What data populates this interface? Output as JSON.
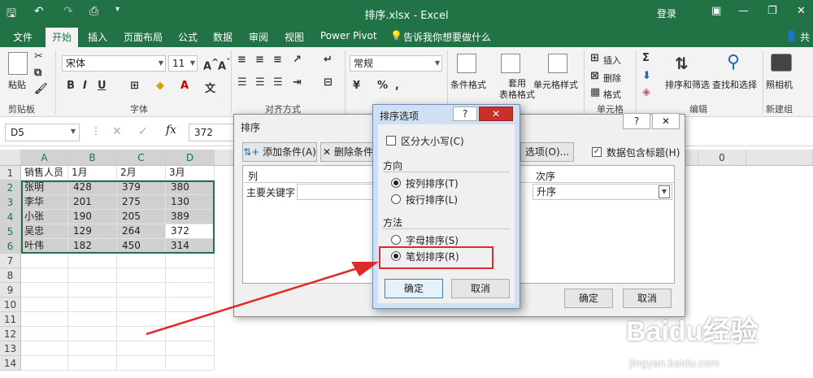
{
  "window": {
    "title": "排序.xlsx  -  Excel",
    "login": "登录"
  },
  "tabs": [
    "文件",
    "开始",
    "插入",
    "页面布局",
    "公式",
    "数据",
    "审阅",
    "视图",
    "Power Pivot"
  ],
  "tell_me": "告诉我你想要做什么",
  "share": "共",
  "ribbon": {
    "paste": "粘贴",
    "clipboard": "剪贴板",
    "font_name": "宋体",
    "font_size": "11",
    "font_group": "字体",
    "align_group": "对齐方式",
    "number_format": "常规",
    "cond_format": "条件格式",
    "table_format": "套用\n表格格式",
    "cell_style": "单元格样式",
    "insert": "插入",
    "delete": "删除",
    "format": "格式",
    "cells_group": "单元格",
    "sort_filter": "排序和筛选",
    "find_select": "查找和选择",
    "edit_group": "编辑",
    "camera": "照相机",
    "new_group": "新建组"
  },
  "formula_bar": {
    "name_box": "D5",
    "value": "372"
  },
  "grid": {
    "columns": [
      "A",
      "B",
      "C",
      "D"
    ],
    "rows": [
      [
        "销售人员",
        "1月",
        "2月",
        "3月"
      ],
      [
        "张明",
        "428",
        "379",
        "380"
      ],
      [
        "李华",
        "201",
        "275",
        "130"
      ],
      [
        "小张",
        "190",
        "205",
        "389"
      ],
      [
        "吴忠",
        "129",
        "264",
        "372"
      ],
      [
        "叶伟",
        "182",
        "450",
        "314"
      ]
    ],
    "row_numbers": [
      "1",
      "2",
      "3",
      "4",
      "5",
      "6",
      "7",
      "8",
      "9",
      "10",
      "11",
      "12",
      "13",
      "14"
    ],
    "extra_col": "0"
  },
  "sort_dialog": {
    "title": "排序",
    "add_condition": "添加条件(A)",
    "delete_condition": "删除条件",
    "options": "选项(O)...",
    "has_header": "数据包含标题(H)",
    "col_header": "列",
    "order_header": "次序",
    "primary_key": "主要关键字",
    "order_value": "升序",
    "ok": "确定",
    "cancel": "取消"
  },
  "options_dialog": {
    "title": "排序选项",
    "case_sensitive": "区分大小写(C)",
    "direction_label": "方向",
    "by_column": "按列排序(T)",
    "by_row": "按行排序(L)",
    "method_label": "方法",
    "by_letter": "字母排序(S)",
    "by_stroke": "笔划排序(R)",
    "ok": "确定",
    "cancel": "取消"
  },
  "watermark": {
    "brand": "Baidu经验",
    "url": "jingyan.baidu.com"
  },
  "colors": {
    "excel_green": "#217346",
    "highlight_red": "#e02a2a"
  }
}
